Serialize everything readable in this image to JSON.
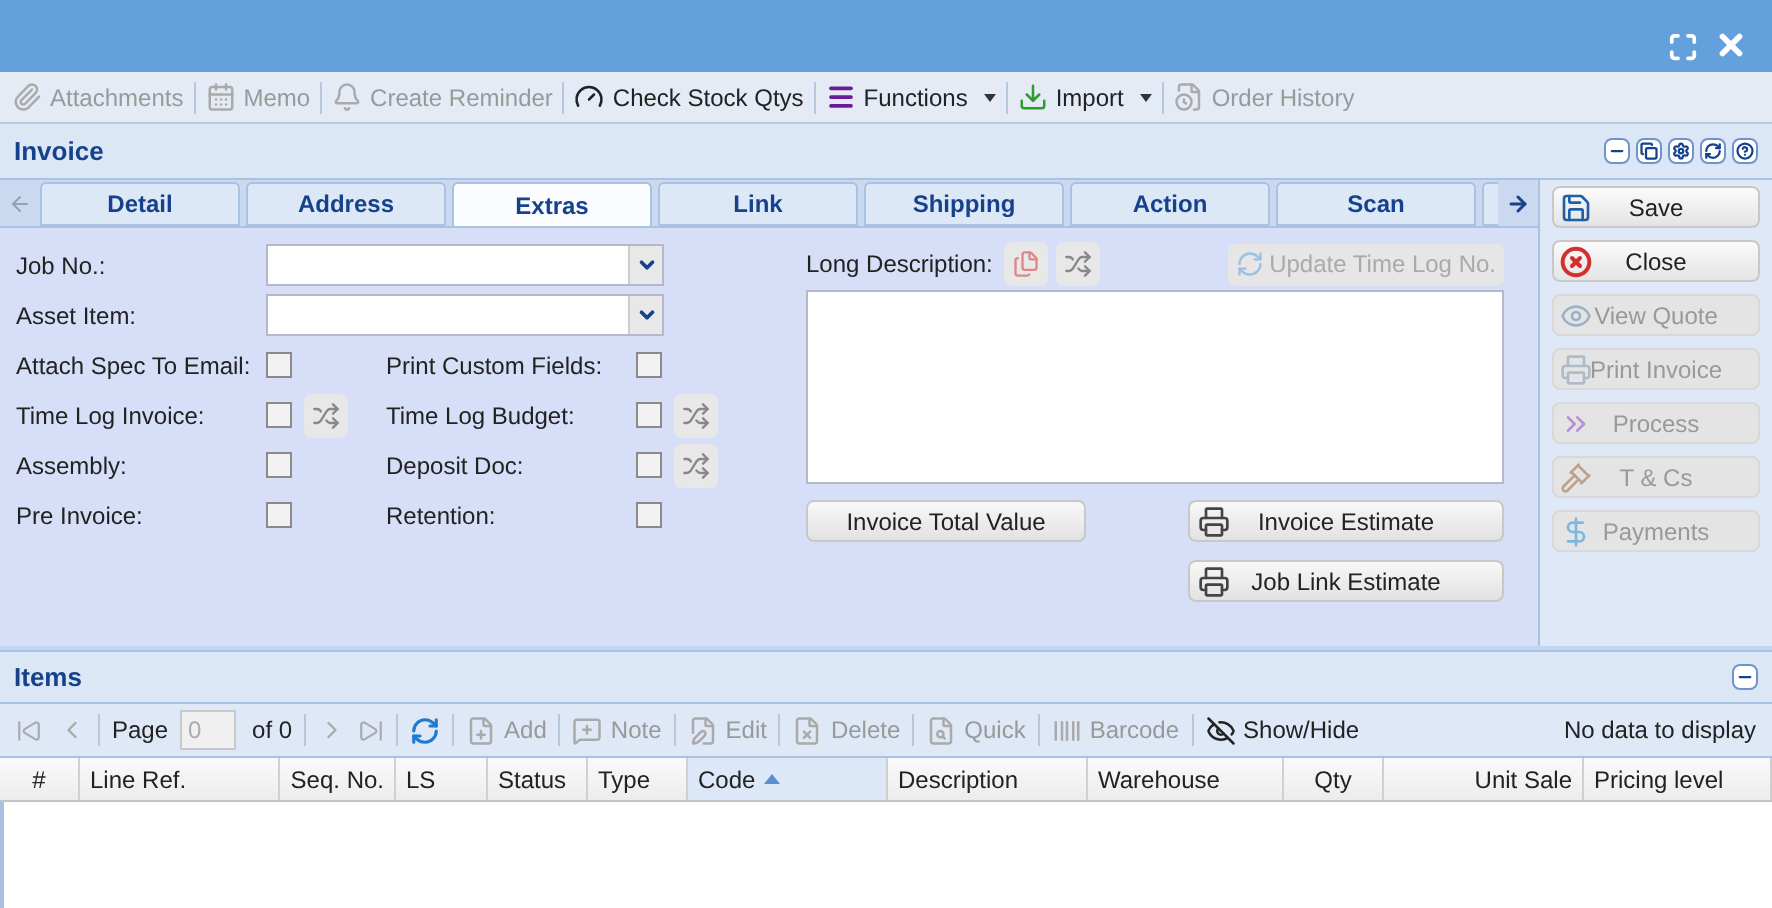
{
  "toolbar": [
    {
      "label": "Attachments",
      "disabled": true,
      "menu": false
    },
    {
      "label": "Memo",
      "disabled": true,
      "menu": false
    },
    {
      "label": "Create Reminder",
      "disabled": true,
      "menu": false
    },
    {
      "label": "Check Stock Qtys",
      "disabled": false,
      "menu": false
    },
    {
      "label": "Functions",
      "disabled": false,
      "menu": true
    },
    {
      "label": "Import",
      "disabled": false,
      "menu": true
    },
    {
      "label": "Order History",
      "disabled": true,
      "menu": false
    }
  ],
  "panel": {
    "title": "Invoice"
  },
  "tabs": [
    {
      "label": "Detail",
      "selected": false
    },
    {
      "label": "Address",
      "selected": false
    },
    {
      "label": "Extras",
      "selected": true
    },
    {
      "label": "Link",
      "selected": false
    },
    {
      "label": "Shipping",
      "selected": false
    },
    {
      "label": "Action",
      "selected": false
    },
    {
      "label": "Scan",
      "selected": false
    }
  ],
  "combos": [
    {
      "label": "Job No.:"
    },
    {
      "label": "Asset Item:"
    }
  ],
  "check_rows": [
    {
      "left": {
        "label": "Attach Spec To Email:",
        "checked": false,
        "shuffle": false
      },
      "right": {
        "label": "Print Custom Fields:",
        "checked": false,
        "shuffle": false
      }
    },
    {
      "left": {
        "label": "Time Log Invoice:",
        "checked": false,
        "shuffle": true
      },
      "right": {
        "label": "Time Log Budget:",
        "checked": false,
        "shuffle": true
      }
    },
    {
      "left": {
        "label": "Assembly:",
        "checked": false,
        "shuffle": false
      },
      "right": {
        "label": "Deposit Doc:",
        "checked": false,
        "shuffle": true
      }
    },
    {
      "left": {
        "label": "Pre Invoice:",
        "checked": false,
        "shuffle": false
      },
      "right": {
        "label": "Retention:",
        "checked": false,
        "shuffle": false
      }
    }
  ],
  "long_description": {
    "label": "Long Description:",
    "update_button": {
      "label": "Update Time Log No.",
      "disabled": true
    }
  },
  "buttons": {
    "total": "Invoice Total Value",
    "estimate": "Invoice Estimate",
    "job_link": "Job Link Estimate"
  },
  "actions": [
    {
      "label": "Save",
      "disabled": false
    },
    {
      "label": "Close",
      "disabled": false
    },
    {
      "label": "View Quote",
      "disabled": true
    },
    {
      "label": "Print Invoice",
      "disabled": true
    },
    {
      "label": "Process",
      "disabled": true
    },
    {
      "label": "T & Cs",
      "disabled": true
    },
    {
      "label": "Payments",
      "disabled": true
    }
  ],
  "items": {
    "title": "Items",
    "pager": {
      "page_label": "Page",
      "page_value": "0",
      "of": "of 0"
    },
    "tools": [
      {
        "label": "Add",
        "disabled": true
      },
      {
        "label": "Note",
        "disabled": true
      },
      {
        "label": "Edit",
        "disabled": true
      },
      {
        "label": "Delete",
        "disabled": true
      },
      {
        "label": "Quick",
        "disabled": true
      },
      {
        "label": "Barcode",
        "disabled": true
      },
      {
        "label": "Show/Hide",
        "disabled": false
      }
    ],
    "status": "No data to display",
    "columns": [
      {
        "label": "#",
        "sorted": false
      },
      {
        "label": "Line Ref.",
        "sorted": false
      },
      {
        "label": "Seq. No.",
        "sorted": false
      },
      {
        "label": "LS",
        "sorted": false
      },
      {
        "label": "Status",
        "sorted": false
      },
      {
        "label": "Type",
        "sorted": false
      },
      {
        "label": "Code",
        "sorted": true
      },
      {
        "label": "Description",
        "sorted": false
      },
      {
        "label": "Warehouse",
        "sorted": false
      },
      {
        "label": "Qty",
        "sorted": false
      },
      {
        "label": "Unit Sale",
        "sorted": false
      },
      {
        "label": "Pricing level",
        "sorted": false
      }
    ]
  }
}
